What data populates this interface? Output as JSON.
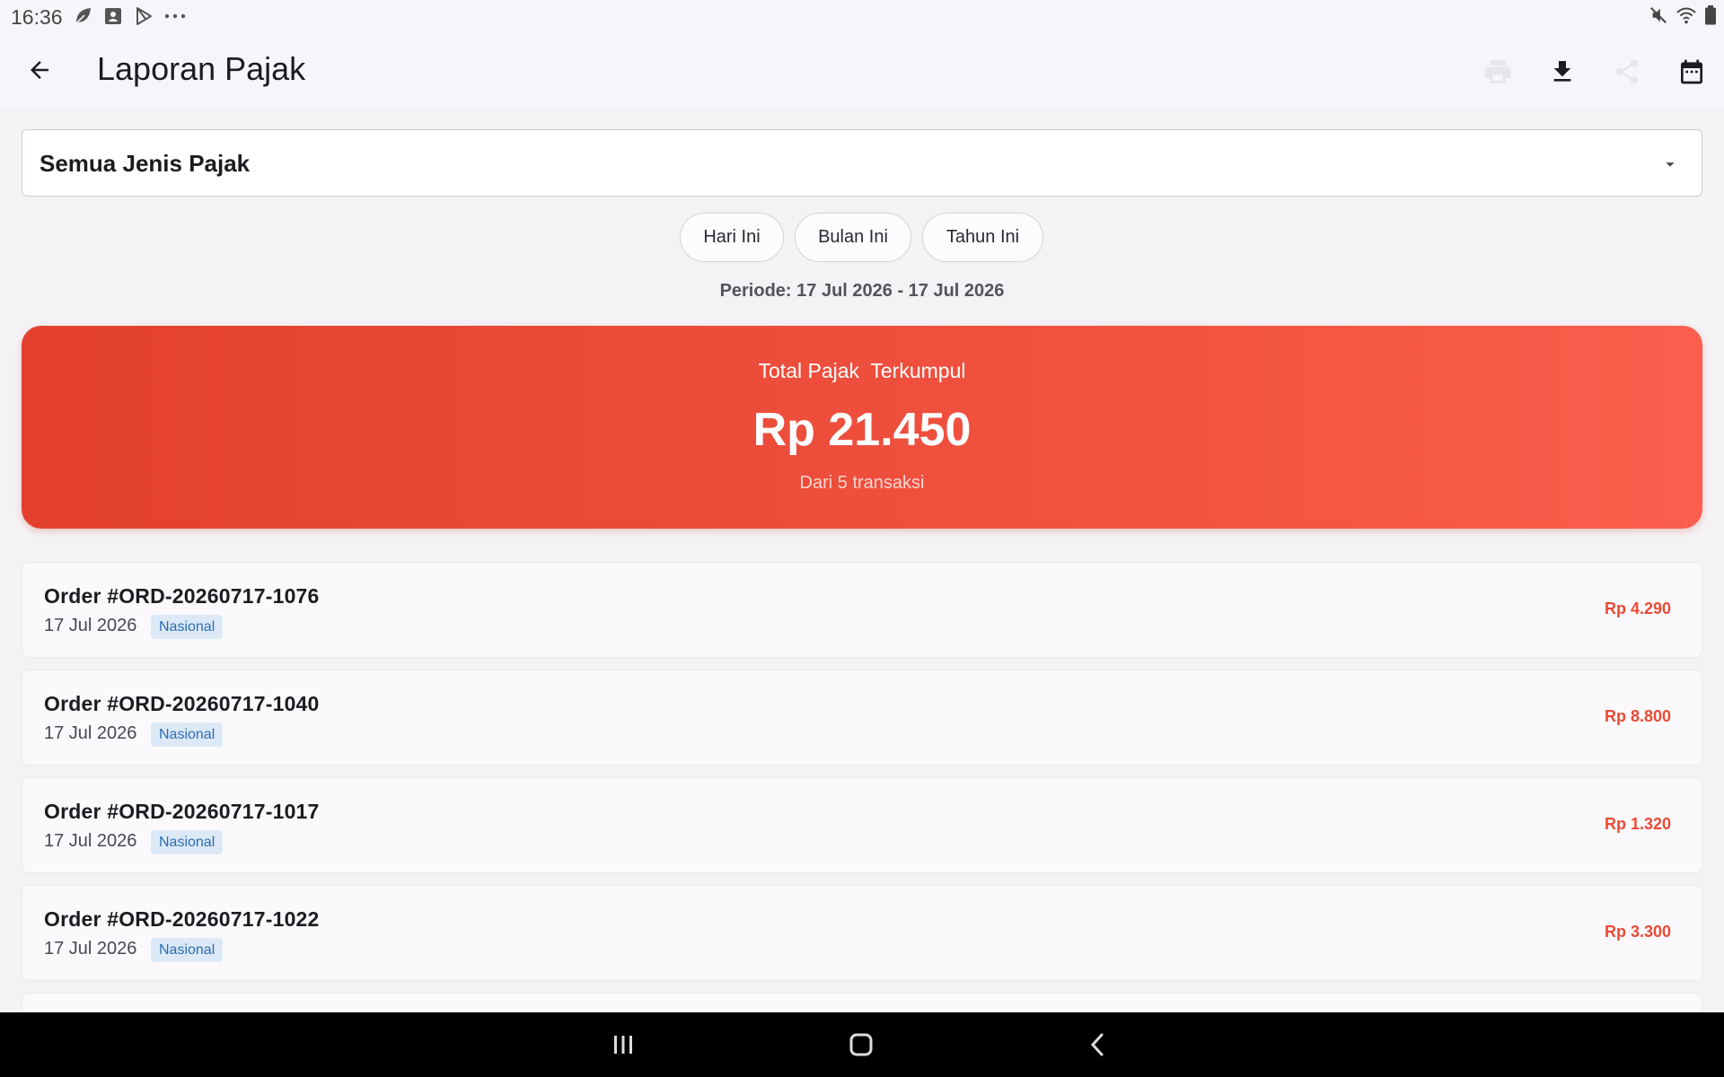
{
  "status_bar": {
    "time": "16:36",
    "left_icons": [
      "leaf-icon",
      "image-notification-icon",
      "play-store-icon",
      "more-dots-icon"
    ],
    "right_icons": [
      "mute-icon",
      "wifi-icon",
      "battery-icon"
    ]
  },
  "app_bar": {
    "title": "Laporan Pajak",
    "actions": [
      "print-icon",
      "download-icon",
      "share-icon",
      "calendar-icon"
    ]
  },
  "filter": {
    "tax_type_selected": "Semua Jenis Pajak"
  },
  "chips": [
    {
      "label": "Hari Ini"
    },
    {
      "label": "Bulan Ini"
    },
    {
      "label": "Tahun Ini"
    }
  ],
  "period": "Periode: 17 Jul 2026 - 17 Jul 2026",
  "summary": {
    "label": "Total Pajak  Terkumpul",
    "amount": "Rp 21.450",
    "subtitle": "Dari 5 transaksi",
    "gradient_start": "#e3402f",
    "gradient_end": "#fb5e4c"
  },
  "orders": [
    {
      "title": "Order #ORD-20260717-1076",
      "date": "17 Jul 2026",
      "badge": "Nasional",
      "amount": "Rp 4.290"
    },
    {
      "title": "Order #ORD-20260717-1040",
      "date": "17 Jul 2026",
      "badge": "Nasional",
      "amount": "Rp 8.800"
    },
    {
      "title": "Order #ORD-20260717-1017",
      "date": "17 Jul 2026",
      "badge": "Nasional",
      "amount": "Rp 1.320"
    },
    {
      "title": "Order #ORD-20260717-1022",
      "date": "17 Jul 2026",
      "badge": "Nasional",
      "amount": "Rp 3.300"
    }
  ],
  "colors": {
    "accent_red": "#ea4a35",
    "badge_bg": "#dde9f6",
    "badge_text": "#2a6db5"
  },
  "nav_bar": {
    "buttons": [
      "recents-icon",
      "home-icon",
      "back-nav-icon"
    ]
  }
}
